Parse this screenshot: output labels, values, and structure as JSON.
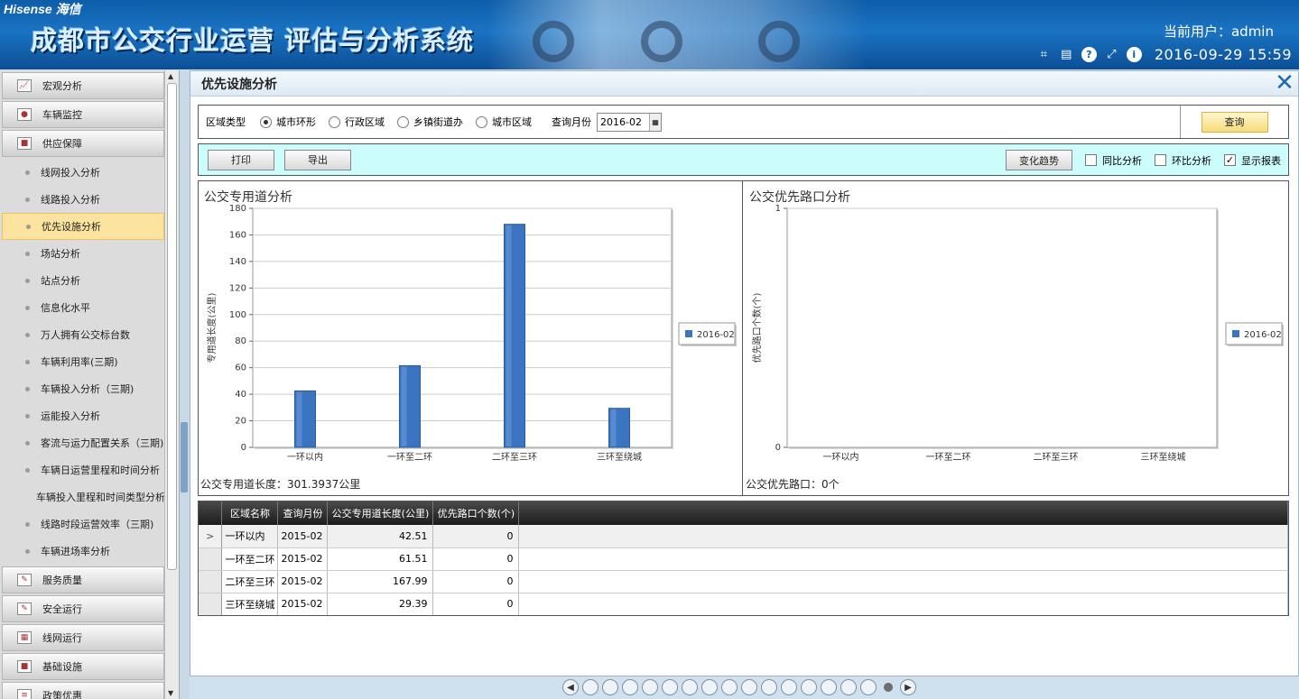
{
  "header": {
    "brand": "Hisense 海信",
    "title": "成都市公交行业运营 评估与分析系统",
    "user": "当前用户：admin",
    "datetime": "2016-09-29 15:59"
  },
  "sidebar": {
    "groups_top": [
      {
        "label": "宏观分析",
        "icon": "chart-icon"
      },
      {
        "label": "车辆监控",
        "icon": "camera-icon"
      },
      {
        "label": "供应保障",
        "icon": "truck-icon"
      }
    ],
    "items": [
      "线网投入分析",
      "线路投入分析",
      "优先设施分析",
      "场站分析",
      "站点分析",
      "信息化水平",
      "万人拥有公交标台数",
      "车辆利用率(三期)",
      "车辆投入分析（三期)",
      "运能投入分析",
      "客流与运力配置关系（三期)",
      "车辆日运营里程和时间分析",
      "车辆投入里程和时间类型分析",
      "线路时段运营效率（三期)",
      "车辆进场率分析"
    ],
    "active_index": 2,
    "groups_bottom": [
      {
        "label": "服务质量",
        "icon": "pencil-icon"
      },
      {
        "label": "安全运行",
        "icon": "pencil-icon"
      },
      {
        "label": "线网运行",
        "icon": "grid-icon"
      },
      {
        "label": "基础设施",
        "icon": "truck-icon"
      },
      {
        "label": "政策优惠",
        "icon": "list-icon"
      }
    ]
  },
  "page": {
    "title": "优先设施分析"
  },
  "query": {
    "area_type_label": "区域类型",
    "options": [
      "城市环形",
      "行政区域",
      "乡镇街道办",
      "城市区域"
    ],
    "selected": 0,
    "month_label": "查询月份",
    "month_value": "2016-02",
    "query_button": "查询"
  },
  "toolbar": {
    "print": "打印",
    "export": "导出",
    "trend": "变化趋势",
    "yoy": "同比分析",
    "mom": "环比分析",
    "show_report": "显示报表",
    "yoy_checked": false,
    "mom_checked": false,
    "show_report_checked": true
  },
  "chart_data": [
    {
      "type": "bar",
      "title": "公交专用道分析",
      "categories": [
        "一环以内",
        "一环至二环",
        "二环至三环",
        "三环至绕城"
      ],
      "series": [
        {
          "name": "2016-02",
          "values": [
            42.51,
            61.51,
            167.99,
            29.39
          ]
        }
      ],
      "ylabel": "专用道长度(公里)",
      "ylim": [
        0,
        180
      ],
      "yticks": [
        0,
        20,
        40,
        60,
        80,
        100,
        120,
        140,
        160,
        180
      ],
      "legend": "right",
      "footer": "公交专用道长度：301.3937公里"
    },
    {
      "type": "bar",
      "title": "公交优先路口分析",
      "categories": [
        "一环以内",
        "一环至二环",
        "二环至三环",
        "三环至绕城"
      ],
      "series": [
        {
          "name": "2016-02",
          "values": [
            0,
            0,
            0,
            0
          ]
        }
      ],
      "ylabel": "优先路口个数(个)",
      "ylim": [
        0,
        1
      ],
      "yticks": [
        0,
        1
      ],
      "legend": "right",
      "footer": "公交优先路口：0个"
    }
  ],
  "table": {
    "columns": [
      "区域名称",
      "查询月份",
      "公交专用道长度(公里)",
      "优先路口个数(个)"
    ],
    "rows": [
      [
        "一环以内",
        "2015-02",
        "42.51",
        "0"
      ],
      [
        "一环至二环",
        "2015-02",
        "61.51",
        "0"
      ],
      [
        "二环至三环",
        "2015-02",
        "167.99",
        "0"
      ],
      [
        "三环至绕城",
        "2015-02",
        "29.39",
        "0"
      ]
    ],
    "selected_row": 0
  },
  "pager": {
    "total": 16,
    "current": 15
  },
  "colors": {
    "accent": "#1a73c2",
    "bar": "#3b74c0",
    "toolbar_bg": "#ccfcfc",
    "active_item": "#fde3a0"
  }
}
